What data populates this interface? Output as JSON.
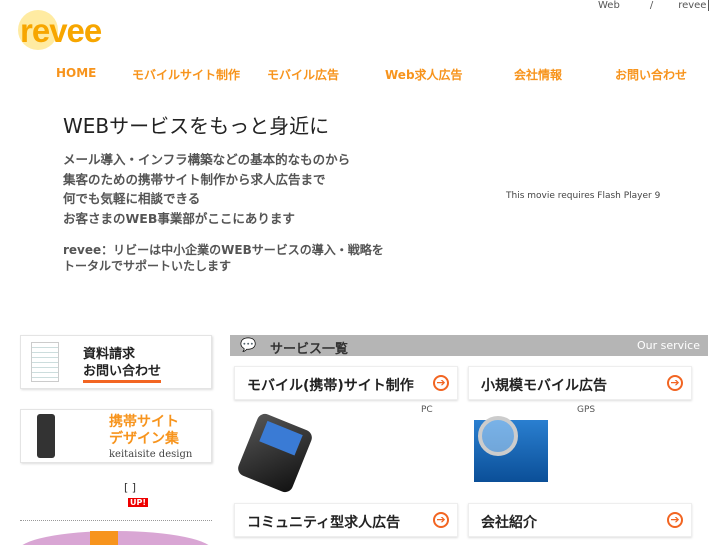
{
  "logo": "revee",
  "top_links": [
    "Web",
    "/",
    "revee"
  ],
  "nav": [
    "HOME",
    "モバイルサイト制作",
    "モバイル広告",
    "Web求人広告",
    "会社情報",
    "お問い合わせ"
  ],
  "hero": {
    "title": "WEBサービスをもっと身近に",
    "lines": [
      "メール導入・インフラ構築などの基本的なものから",
      "集客のための携帯サイト制作から求人広告まで",
      "何でも気軽に相談できる",
      "お客さまのWEB事業部がここにあります"
    ],
    "sub": [
      "revee：リビーは中小企業のWEBサービスの導入・戦略を",
      "トータルでサポートいたします"
    ]
  },
  "flash_notice": "This movie requires Flash Player 9",
  "sidebar": {
    "banner1": [
      "資料請求",
      "お問い合わせ"
    ],
    "banner2": [
      "携帯サイト",
      "デザイン集"
    ],
    "banner2_sub": "keitaisite design",
    "brackets": "[ ]",
    "up_badge": "UP!"
  },
  "services": {
    "title": "サービス一覧",
    "subtitle": "Our service",
    "cards": [
      {
        "label": "モバイル(携帯)サイト制作",
        "note": "PC"
      },
      {
        "label": "小規模モバイル広告",
        "note": "GPS"
      },
      {
        "label": "コミュニティ型求人広告"
      },
      {
        "label": "会社紹介"
      }
    ],
    "arrow": "➔"
  }
}
